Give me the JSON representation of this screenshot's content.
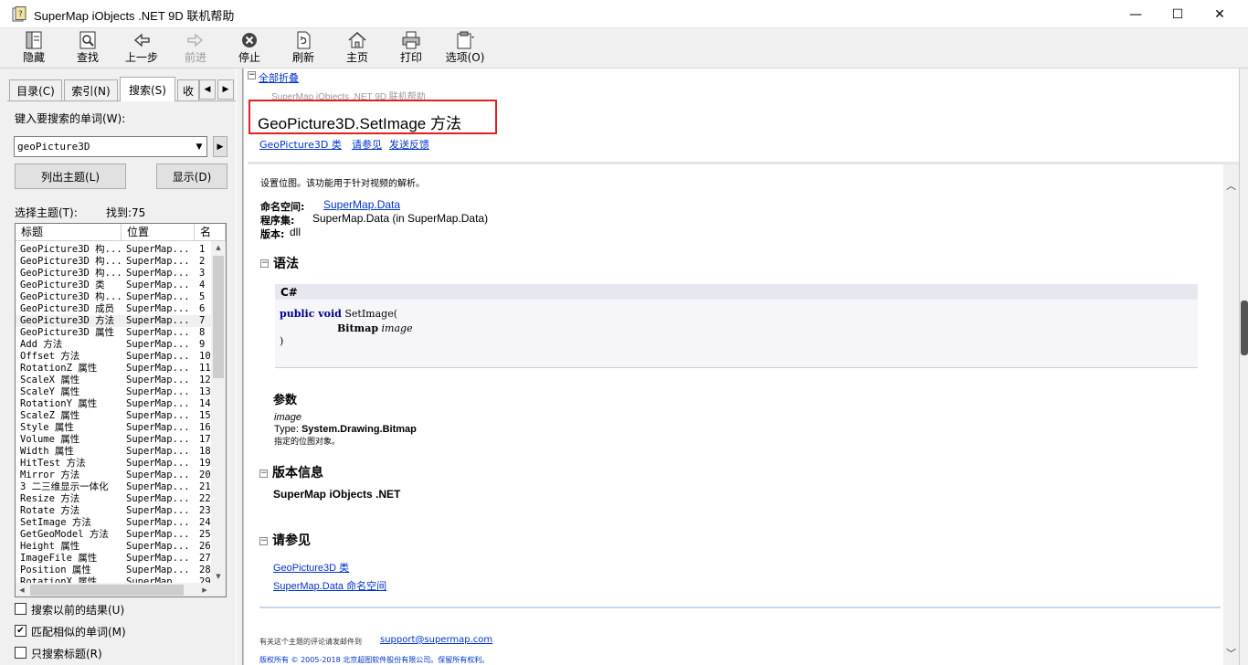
{
  "window": {
    "title": "SuperMap iObjects .NET 9D 联机帮助",
    "minimize": "—",
    "maximize": "☐",
    "close": "✕"
  },
  "toolbar": {
    "hide": "隐藏",
    "find": "查找",
    "back": "上一步",
    "forward": "前进",
    "stop": "停止",
    "refresh": "刷新",
    "home": "主页",
    "print": "打印",
    "options": "选项(O)"
  },
  "tabs": {
    "contents": "目录(C)",
    "index": "索引(N)",
    "search": "搜索(S)",
    "favorites": "收"
  },
  "search": {
    "prompt": "键入要搜索的单词(W):",
    "query": "geoPicture3D",
    "list_button": "列出主题(L)",
    "display_button": "显示(D)",
    "select_label": "选择主题(T):",
    "found": "找到:75"
  },
  "results": {
    "headers": [
      "标题",
      "位置",
      "名"
    ],
    "rows": [
      [
        "GeoPicture3D 构...",
        "SuperMap...",
        "1"
      ],
      [
        "GeoPicture3D 构...",
        "SuperMap...",
        "2"
      ],
      [
        "GeoPicture3D 构...",
        "SuperMap...",
        "3"
      ],
      [
        "GeoPicture3D 类",
        "SuperMap...",
        "4"
      ],
      [
        "GeoPicture3D 构...",
        "SuperMap...",
        "5"
      ],
      [
        "GeoPicture3D 成员",
        "SuperMap...",
        "6"
      ],
      [
        "GeoPicture3D 方法",
        "SuperMap...",
        "7"
      ],
      [
        "GeoPicture3D 属性",
        "SuperMap...",
        "8"
      ],
      [
        "Add 方法",
        "SuperMap...",
        "9"
      ],
      [
        "Offset 方法",
        "SuperMap...",
        "10"
      ],
      [
        "RotationZ 属性",
        "SuperMap...",
        "11"
      ],
      [
        "ScaleX 属性",
        "SuperMap...",
        "12"
      ],
      [
        "ScaleY 属性",
        "SuperMap...",
        "13"
      ],
      [
        "RotationY 属性",
        "SuperMap...",
        "14"
      ],
      [
        "ScaleZ 属性",
        "SuperMap...",
        "15"
      ],
      [
        "Style 属性",
        "SuperMap...",
        "16"
      ],
      [
        "Volume 属性",
        "SuperMap...",
        "17"
      ],
      [
        "Width 属性",
        "SuperMap...",
        "18"
      ],
      [
        "HitTest 方法",
        "SuperMap...",
        "19"
      ],
      [
        "Mirror 方法",
        "SuperMap...",
        "20"
      ],
      [
        "3 二三维显示一体化",
        "SuperMap...",
        "21"
      ],
      [
        "Resize 方法",
        "SuperMap...",
        "22"
      ],
      [
        "Rotate 方法",
        "SuperMap...",
        "23"
      ],
      [
        "SetImage 方法",
        "SuperMap...",
        "24"
      ],
      [
        "GetGeoModel 方法",
        "SuperMap...",
        "25"
      ],
      [
        "Height 属性",
        "SuperMap...",
        "26"
      ],
      [
        "ImageFile 属性",
        "SuperMap...",
        "27"
      ],
      [
        "Position 属性",
        "SuperMap...",
        "28"
      ],
      [
        "RotationX 属性",
        "SuperMap...",
        "29"
      ]
    ],
    "selected_index": 6
  },
  "options": {
    "search_previous": {
      "label": "搜索以前的结果(U)",
      "checked": false
    },
    "match_similar": {
      "label": "匹配相似的单词(M)",
      "checked": true
    },
    "titles_only": {
      "label": "只搜索标题(R)",
      "checked": false
    }
  },
  "doc": {
    "collapse_all": "全部折叠",
    "breadcrumb": "SuperMap iObjects .NET 9D 联机帮助",
    "title": "GeoPicture3D.SetImage 方法",
    "links": [
      "GeoPicture3D 类",
      "请参见",
      "发送反馈"
    ],
    "description": "设置位图。该功能用于针对视频的解析。",
    "namespace_label": "命名空间:",
    "namespace": "SuperMap.Data",
    "assembly_label": "程序集:",
    "assembly": "SuperMap.Data (in SuperMap.Data)",
    "version_label": "版本:",
    "version": "dll",
    "syntax_heading": "语法",
    "code_lang": "C#",
    "code_line1_kw": "public void",
    "code_line1_rest": " SetImage(",
    "code_line2_type": "Bitmap",
    "code_line2_param": "image",
    "code_line3": ")",
    "params_heading": "参数",
    "param_name": "image",
    "param_type_label": "Type: ",
    "param_type": "System.Drawing.Bitmap",
    "param_desc": "指定的位图对象。",
    "version_heading": "版本信息",
    "version_info": "SuperMap iObjects .NET",
    "seealso_heading": "请参见",
    "seealso": [
      "GeoPicture3D 类",
      "SuperMap.Data 命名空间"
    ],
    "footer_text": "有关这个主题的评论请发邮件到",
    "footer_email": "support@supermap.com",
    "copyright": "版权所有 © 2005-2018 北京超图软件股份有限公司。保留所有权利。"
  },
  "colors": {
    "highlight_box": "#e02020",
    "link": "#0033cc"
  }
}
